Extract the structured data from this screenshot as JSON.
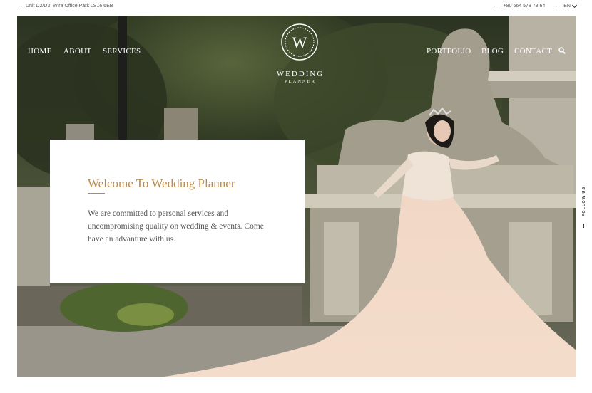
{
  "topbar": {
    "address": "Unit D2/D3, Wira Office Park LS16 6EB",
    "phone": "+80 664 578 78 64",
    "language": "EN"
  },
  "nav": {
    "left": [
      "HOME",
      "ABOUT",
      "SERVICES"
    ],
    "right": [
      "PORTFOLIO",
      "BLOG",
      "CONTACT"
    ]
  },
  "logo": {
    "letter": "W",
    "line1": "WEDDING",
    "line2": "PLANNER"
  },
  "welcome": {
    "title": "Welcome To Wedding Planner",
    "body": "We are committed to personal services and uncompromising quality on wedding & events. Come have an advanture with us."
  },
  "side": {
    "follow": "FOLLOW US"
  },
  "colors": {
    "accent": "#b88a4a",
    "text": "#555555",
    "white": "#ffffff"
  },
  "icons": {
    "search": "search-icon",
    "chevron": "chevron-down-icon"
  }
}
